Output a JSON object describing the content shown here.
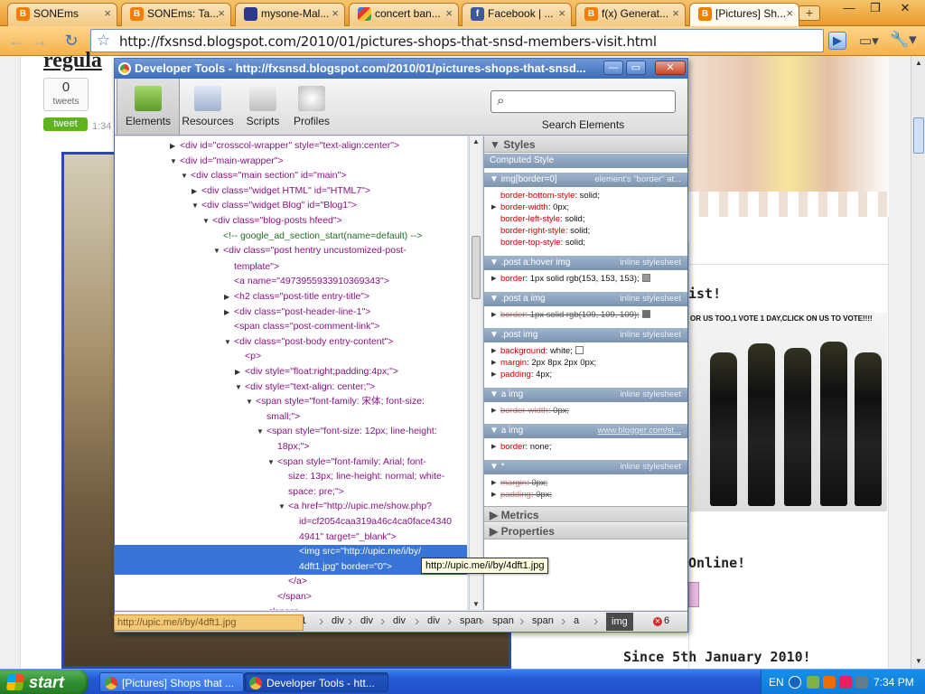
{
  "browser": {
    "tabs": [
      {
        "title": "SONEms",
        "icon": "blogger-icon",
        "fav": "blogger",
        "active": false
      },
      {
        "title": "SONEms: Ta...",
        "icon": "blogger-icon",
        "fav": "blogger",
        "active": false
      },
      {
        "title": "mysone-Mal...",
        "icon": "mysone-icon",
        "fav": "mysone",
        "active": false
      },
      {
        "title": "concert ban...",
        "icon": "google-icon",
        "fav": "google",
        "active": false
      },
      {
        "title": "Facebook | ...",
        "icon": "facebook-icon",
        "fav": "facebook",
        "active": false
      },
      {
        "title": "f(x) Generat...",
        "icon": "blogger-icon",
        "fav": "blogger",
        "active": false
      },
      {
        "title": "[Pictures] Sh...",
        "icon": "blogger-icon",
        "fav": "blogger",
        "active": true
      }
    ],
    "new_tab": "+",
    "window_controls": {
      "minimize": "—",
      "restore": "❐",
      "close": "✕"
    },
    "nav": {
      "back": "←",
      "forward": "→",
      "reload": "↻",
      "star": "☆"
    },
    "url_prefix": "http://",
    "url_host": "fxsnsd.blogspot.com",
    "url_path": "/2010/01/pictures-shops-that-snsd-members-visit.html",
    "go": "▶",
    "page_menu": "▭▾",
    "wrench": "🔧▾"
  },
  "page": {
    "title_fragment": "regula",
    "tweet_count": "0",
    "tweet_count_label": "tweets",
    "tweet_button": "tweet",
    "time_fragment": "1:34",
    "sidebar_heading_1": "ist!",
    "vote_banner": "OR US TOO,1 VOTE 1 DAY,CLICK ON US TO VOTE!!!!",
    "sidebar_heading_2": "Online!",
    "since": "Since 5th January 2010!"
  },
  "devtools": {
    "title": "Developer Tools - http://fxsnsd.blogspot.com/2010/01/pictures-shops-that-snsd...",
    "window_controls": {
      "minimize": "—",
      "restore": "▭",
      "close": "✕"
    },
    "tools": [
      {
        "label": "Elements",
        "active": true
      },
      {
        "label": "Resources",
        "active": false
      },
      {
        "label": "Scripts",
        "active": false
      },
      {
        "label": "Profiles",
        "active": false
      }
    ],
    "search_placeholder": "",
    "search_label": "Search Elements",
    "tree": [
      {
        "indent": 0,
        "tri": "▶",
        "html": "<div id=\"crosscol-wrapper\" style=\"text-align:center\">"
      },
      {
        "indent": 0,
        "tri": "▼",
        "html": "<div id=\"main-wrapper\">"
      },
      {
        "indent": 1,
        "tri": "▼",
        "html": "<div class=\"main section\" id=\"main\">"
      },
      {
        "indent": 2,
        "tri": "▶",
        "html": "<div class=\"widget HTML\" id=\"HTML7\">"
      },
      {
        "indent": 2,
        "tri": "▼",
        "html": "<div class=\"widget Blog\" id=\"Blog1\">"
      },
      {
        "indent": 3,
        "tri": "▼",
        "html": "<div class=\"blog-posts hfeed\">"
      },
      {
        "indent": 4,
        "tri": "",
        "html": "<!-- google_ad_section_start(name=default) -->"
      },
      {
        "indent": 4,
        "tri": "▼",
        "html": "<div class=\"post hentry uncustomized-post-"
      },
      {
        "indent": 5,
        "tri": "",
        "html": "template\">"
      },
      {
        "indent": 5,
        "tri": "",
        "html": "<a name=\"4973955933910369343\">"
      },
      {
        "indent": 5,
        "tri": "▶",
        "html": "<h2 class=\"post-title entry-title\">"
      },
      {
        "indent": 5,
        "tri": "▶",
        "html": "<div class=\"post-header-line-1\">"
      },
      {
        "indent": 5,
        "tri": "",
        "html": "<span class=\"post-comment-link\">"
      },
      {
        "indent": 5,
        "tri": "▼",
        "html": "<div class=\"post-body entry-content\">"
      },
      {
        "indent": 6,
        "tri": "",
        "html": "<p>"
      },
      {
        "indent": 6,
        "tri": "▶",
        "html": "<div style=\"float:right;padding:4px;\">"
      },
      {
        "indent": 6,
        "tri": "▼",
        "html": "<div style=\"text-align: center;\">"
      },
      {
        "indent": 7,
        "tri": "▼",
        "html": "<span style=\"font-family: 宋体; font-size:"
      },
      {
        "indent": 8,
        "tri": "",
        "html": "small;\">"
      },
      {
        "indent": 8,
        "tri": "▼",
        "html": "<span style=\"font-size: 12px; line-height:"
      },
      {
        "indent": 9,
        "tri": "",
        "html": "18px;\">"
      },
      {
        "indent": 9,
        "tri": "▼",
        "html": "<span style=\"font-family: Arial; font-"
      },
      {
        "indent": 10,
        "tri": "",
        "html": "size: 13px; line-height: normal; white-"
      },
      {
        "indent": 10,
        "tri": "",
        "html": "space: pre;\">"
      },
      {
        "indent": 10,
        "tri": "▼",
        "html": "<a href=\"http://upic.me/show.php?"
      },
      {
        "indent": 11,
        "tri": "",
        "html": "id=cf2054caa319a46c4ca0face4340"
      },
      {
        "indent": 11,
        "tri": "",
        "html": "4941\" target=\"_blank\">"
      },
      {
        "indent": 11,
        "tri": "",
        "html": "<img src=\"http://upic.me/i/by/",
        "selected": true
      },
      {
        "indent": 11,
        "tri": "",
        "html": "4dft1.jpg\" border=\"0\">",
        "selected": true
      },
      {
        "indent": 10,
        "tri": "",
        "html": "</a>"
      },
      {
        "indent": 9,
        "tri": "",
        "html": "</span>"
      },
      {
        "indent": 8,
        "tri": "",
        "html": "</span>"
      }
    ],
    "styles": {
      "header": "Styles",
      "computed": "Computed Style",
      "rules": [
        {
          "selector": "img[border=0]",
          "source": "element's \"border\" at...",
          "link": false,
          "props": [
            {
              "name": "border-bottom-style",
              "value": "solid;",
              "tri": false
            },
            {
              "name": "border-width",
              "value": "0px;",
              "tri": true
            },
            {
              "name": "border-left-style",
              "value": "solid;",
              "tri": false
            },
            {
              "name": "border-right-style",
              "value": "solid;",
              "tri": false
            },
            {
              "name": "border-top-style",
              "value": "solid;",
              "tri": false
            }
          ]
        },
        {
          "selector": ".post a:hover img",
          "source": "inline stylesheet",
          "link": false,
          "props": [
            {
              "name": "border",
              "value": "1px solid rgb(153, 153, 153);",
              "tri": true,
              "swatch": "#999999"
            }
          ]
        },
        {
          "selector": ".post a img",
          "source": "inline stylesheet",
          "link": false,
          "props": [
            {
              "name": "border",
              "value": "1px solid rgb(109, 109, 109);",
              "tri": true,
              "swatch": "#6d6d6d",
              "strike": true
            }
          ]
        },
        {
          "selector": ".post img",
          "source": "inline stylesheet",
          "link": false,
          "props": [
            {
              "name": "background",
              "value": "white;",
              "tri": true,
              "swatch": "#ffffff"
            },
            {
              "name": "margin",
              "value": "2px 8px 2px 0px;",
              "tri": true
            },
            {
              "name": "padding",
              "value": "4px;",
              "tri": true
            }
          ]
        },
        {
          "selector": "a img",
          "source": "inline stylesheet",
          "link": false,
          "props": [
            {
              "name": "border-width",
              "value": "0px;",
              "tri": true,
              "strike": true
            }
          ]
        },
        {
          "selector": "a img",
          "source": "www.blogger.com/st...",
          "link": true,
          "props": [
            {
              "name": "border",
              "value": "none;",
              "tri": true
            }
          ]
        },
        {
          "selector": "*",
          "source": "inline stylesheet",
          "link": false,
          "props": [
            {
              "name": "margin",
              "value": "0px;",
              "tri": true,
              "strike": true
            },
            {
              "name": "padding",
              "value": "0px;",
              "tri": true,
              "strike": true
            }
          ]
        }
      ],
      "metrics": "Metrics",
      "properties": "Properties"
    },
    "breadcrumbs": [
      "g1",
      "div",
      "div",
      "div",
      "div",
      "span",
      "span",
      "span",
      "a",
      "img"
    ],
    "error_count": "6",
    "tooltip": "http://upic.me/i/by/4dft1.jpg",
    "status_url": "http://upic.me/i/by/4dft1.jpg"
  },
  "taskbar": {
    "start": "start",
    "tasks": [
      {
        "label": "[Pictures] Shops that ...",
        "active": false
      },
      {
        "label": "Developer Tools - htt...",
        "active": true
      }
    ],
    "lang": "EN",
    "clock": "7:34 PM"
  },
  "colors": {
    "chrome_orange": "#f4b24c",
    "devtools_blue": "#3e6cb8",
    "selection": "#3875d7",
    "taskbar": "#2359d6"
  }
}
